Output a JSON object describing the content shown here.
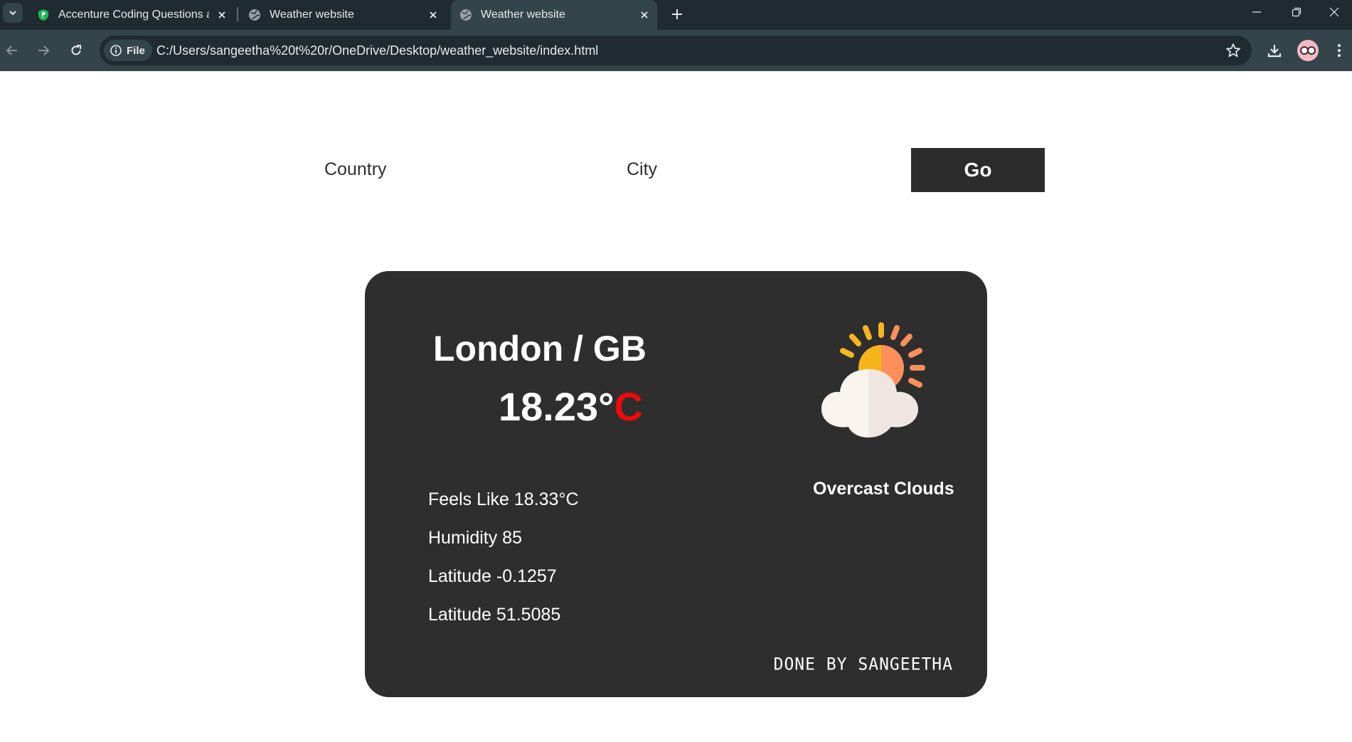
{
  "browser": {
    "tabs": [
      {
        "title": "Accenture Coding Questions ar",
        "icon": "green-shield-favicon",
        "active": false
      },
      {
        "title": "Weather website",
        "icon": "globe-favicon",
        "active": false
      },
      {
        "title": "Weather website",
        "icon": "globe-favicon",
        "active": true
      }
    ],
    "site_chip_label": "File",
    "url": "C:/Users/sangeetha%20t%20r/OneDrive/Desktop/weather_website/index.html"
  },
  "form": {
    "country_label": "Country",
    "city_label": "City",
    "go_label": "Go"
  },
  "weather": {
    "location": "London / GB",
    "temperature": "18.23",
    "degree_symbol": "°",
    "unit": "C",
    "unit_color": "#ee0a0a",
    "icon": "partly-cloudy-sun-icon",
    "description": "Overcast Clouds",
    "details": [
      "Feels Like 18.33°C",
      "Humidity 85",
      "Latitude -0.1257",
      "Latitude 51.5085"
    ],
    "credit": "DONE BY SANGEETHA"
  },
  "colors": {
    "card_background": "#2e2e2e",
    "button_background": "#2c2c2c",
    "chrome_dark": "#1f2b30",
    "chrome_toolbar": "#34444b"
  }
}
